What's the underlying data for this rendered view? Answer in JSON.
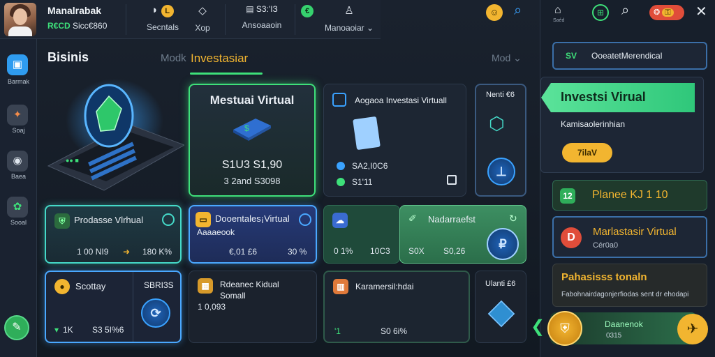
{
  "topbar": {
    "user_name": "Manalrabak",
    "user_code": "R€CD",
    "user_amount": "Sicc€860",
    "items": [
      {
        "label": "Secntals",
        "icon": "chart-coin-icon"
      },
      {
        "label": "Xop",
        "icon": "diamond-icon"
      },
      {
        "label": "Ansoaaoin",
        "value": "S3:'IЗ",
        "icon": "terminal-icon"
      },
      {
        "label": "Manoaoiar",
        "icon": "bell-icon"
      }
    ]
  },
  "header_right": {
    "search_label": "search",
    "house_label": "Saéd"
  },
  "sidebar": {
    "items": [
      {
        "label": "Barmak",
        "icon": "wallet-icon"
      },
      {
        "label": "Soaj",
        "icon": "gift-icon"
      },
      {
        "label": "Baea",
        "icon": "box-icon"
      },
      {
        "label": "Sooal",
        "icon": "community-icon"
      }
    ]
  },
  "main": {
    "section_title": "Bisinis",
    "tabs": [
      {
        "label": "Modk",
        "active": false
      },
      {
        "label": "Investasiar",
        "active": true
      }
    ],
    "more_label": "Mod",
    "featured": {
      "title": "Mestuai Virtual",
      "value": "S1U3 S1,90",
      "sub": "3 2and S3098"
    },
    "info_card": {
      "title": "Aogaoa Investasi Virtuall",
      "value1": "SA2,I0C6",
      "value2": "S1'11"
    },
    "side_card": {
      "title": "Nenti €6"
    },
    "row2": [
      {
        "title": "Prodasse Vlrhual",
        "v1": "1 00 NI9",
        "v2": "180 K%"
      },
      {
        "title": "Dooentales¡Virtual",
        "sub": "Aaaaeook",
        "v1": "€,01 £6",
        "v2": "30 %"
      },
      {
        "title": "",
        "v1": "0 1%",
        "v2": "10C3"
      },
      {
        "title": "Nadarraefst",
        "v1": "S0X",
        "v2": "S0,26"
      }
    ],
    "row3": [
      {
        "title": "Scottay",
        "title2": "SBRI3S",
        "v1": "1K",
        "v2": "S3 5I%6"
      },
      {
        "title": "Rdeanec Kidual",
        "sub": "Somall",
        "v1": "1 0,093"
      },
      {
        "title": "Karamersil:hdai",
        "v1": "'1",
        "v2": "S0 6i%"
      },
      {
        "title": "Ulanti £6"
      }
    ]
  },
  "right_panel": {
    "header_card": "OoeatetMerendical",
    "header_badge": "SV",
    "banner": "Investsi Virual",
    "banner_sub": "Kamisaolerinhian",
    "banner_button": "7ilaV",
    "items": [
      {
        "title": "Planee KJ 1 10",
        "badge": "12"
      },
      {
        "title": "Marlastasir Virtual",
        "sub": "Cér0a0",
        "badge": "D"
      },
      {
        "title": "Pahasisss tonaln",
        "sub": "Fabohnairdagonjerfiodas sent dr ehodapi"
      }
    ],
    "bottom": {
      "title": "Daanenok",
      "sub": "0315"
    }
  },
  "colors": {
    "accent_green": "#3ee07a",
    "accent_gold": "#f2b530",
    "accent_blue": "#3aa2ff"
  }
}
